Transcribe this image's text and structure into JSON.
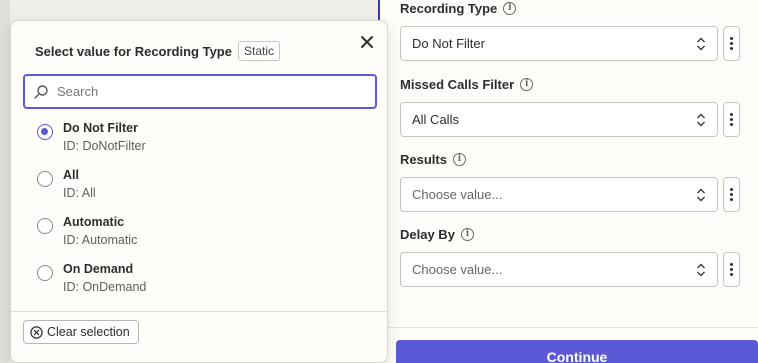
{
  "modal": {
    "title": "Select value for Recording Type",
    "badge": "Static",
    "search_placeholder": "Search",
    "options": [
      {
        "label": "Do Not Filter",
        "id": "ID: DoNotFilter",
        "selected": true
      },
      {
        "label": "All",
        "id": "ID: All",
        "selected": false
      },
      {
        "label": "Automatic",
        "id": "ID: Automatic",
        "selected": false
      },
      {
        "label": "On Demand",
        "id": "ID: OnDemand",
        "selected": false
      }
    ],
    "clear_label": "Clear selection"
  },
  "form": {
    "fields": [
      {
        "label": "Recording Type",
        "value": "Do Not Filter",
        "is_placeholder": false
      },
      {
        "label": "Missed Calls Filter",
        "value": "All Calls",
        "is_placeholder": false
      },
      {
        "label": "Results",
        "value": "Choose value...",
        "is_placeholder": true
      },
      {
        "label": "Delay By",
        "value": "Choose value...",
        "is_placeholder": true
      }
    ],
    "continue_label": "Continue"
  },
  "colors": {
    "accent": "#5b5ad6",
    "panel_border": "#3b3ab4"
  }
}
